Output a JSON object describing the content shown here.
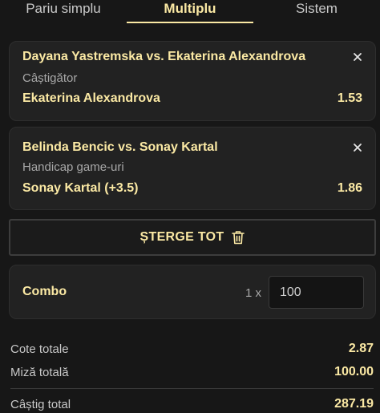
{
  "tabs": [
    {
      "label": "Pariu simplu",
      "active": false
    },
    {
      "label": "Multiplu",
      "active": true
    },
    {
      "label": "Sistem",
      "active": false
    }
  ],
  "selections": [
    {
      "match": "Dayana Yastremska vs. Ekaterina Alexandrova",
      "market": "Câștigător",
      "pick": "Ekaterina Alexandrova",
      "odds": "1.53",
      "close_icon": "close-icon"
    },
    {
      "match": "Belinda Bencic vs. Sonay Kartal",
      "market": "Handicap game-uri",
      "pick": "Sonay Kartal (+3.5)",
      "odds": "1.86",
      "close_icon": "close-icon"
    }
  ],
  "clear_all": {
    "label": "ȘTERGE TOT",
    "icon": "trash-icon"
  },
  "combo": {
    "label": "Combo",
    "multiplier": "1 x",
    "stake_value": "100"
  },
  "summary": {
    "total_odds_label": "Cote totale",
    "total_odds_value": "2.87",
    "total_stake_label": "Miză totală",
    "total_stake_value": "100.00",
    "total_win_label": "Câștig total",
    "total_win_value": "287.19"
  },
  "colors": {
    "accent": "#fbe9a4",
    "background": "#171717",
    "card": "#222222",
    "muted_text": "#a8a8a8"
  }
}
